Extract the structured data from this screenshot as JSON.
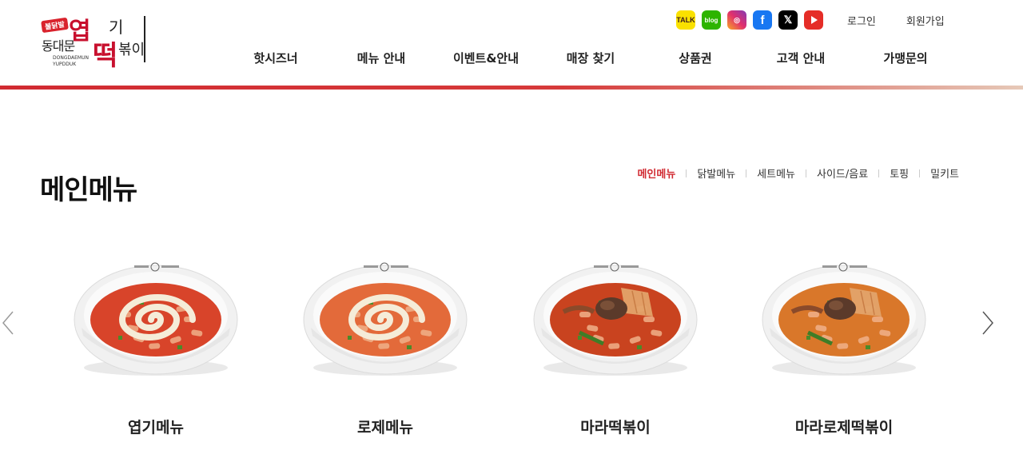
{
  "logo": {
    "badge": "불닭발",
    "line1_a": "엽",
    "line1_b": "기",
    "line2_a": "동대문",
    "line2_b": "떡",
    "line2_c": "볶이",
    "english1": "DONGDAEMUN",
    "english2": "YUPDDUK"
  },
  "social": [
    {
      "name": "kakao-talk-icon",
      "text": "TALK"
    },
    {
      "name": "naver-blog-icon",
      "text": "blog"
    },
    {
      "name": "instagram-icon",
      "text": "◎"
    },
    {
      "name": "facebook-icon",
      "text": "f"
    },
    {
      "name": "x-twitter-icon",
      "text": "𝕏"
    },
    {
      "name": "youtube-icon",
      "text": ""
    }
  ],
  "util": {
    "login": "로그인",
    "signup": "회원가입"
  },
  "gnb": [
    "핫시즈너",
    "메뉴 안내",
    "이벤트&안내",
    "매장 찾기",
    "상품권",
    "고객 안내",
    "가맹문의"
  ],
  "page": {
    "title": "메인메뉴"
  },
  "tabs": [
    {
      "label": "메인메뉴",
      "active": true
    },
    {
      "label": "닭발메뉴",
      "active": false
    },
    {
      "label": "세트메뉴",
      "active": false
    },
    {
      "label": "사이드/음료",
      "active": false
    },
    {
      "label": "토핑",
      "active": false
    },
    {
      "label": "밀키트",
      "active": false
    }
  ],
  "menu_items": [
    {
      "name": "엽기메뉴",
      "sauce": "#d8442a",
      "style": "swirl"
    },
    {
      "name": "로제메뉴",
      "sauce": "#e36a3a",
      "style": "swirl"
    },
    {
      "name": "마라떡볶이",
      "sauce": "#c9431f",
      "style": "mala"
    },
    {
      "name": "마라로제떡볶이",
      "sauce": "#d9772a",
      "style": "mala"
    }
  ],
  "colors": {
    "accent": "#d12a31",
    "bowl": "#f4f4f4"
  }
}
